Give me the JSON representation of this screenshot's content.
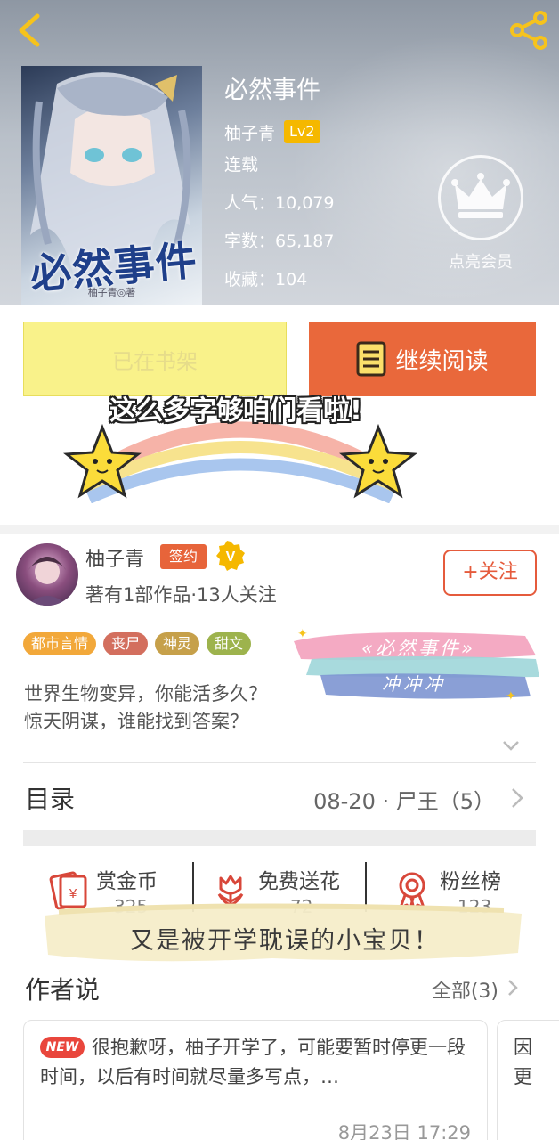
{
  "header": {
    "back_icon": "chevron-left-icon",
    "share_icon": "share-icon"
  },
  "book": {
    "cover_title": "必然事件",
    "cover_author": "柚子青◎著",
    "title": "必然事件",
    "author": "柚子青",
    "level": "Lv2",
    "status": "连载",
    "popularity": "人气：10,079",
    "word_count": "字数：65,187",
    "favorites": "收藏：104"
  },
  "vip": {
    "icon": "crown-icon",
    "label": "点亮会员"
  },
  "actions": {
    "shelf_label": "已在书架",
    "read_label": "继续阅读",
    "read_icon": "book-icon"
  },
  "sticker": {
    "text": "这么多字够咱们看啦!"
  },
  "author_section": {
    "name": "柚子青",
    "sign_badge": "签约",
    "verified_icon": "v-badge-icon",
    "meta": "著有1部作品·13人关注",
    "follow_label": "+关注"
  },
  "tags": [
    {
      "label": "都市言情",
      "color": "#f2a83a"
    },
    {
      "label": "丧尸",
      "color": "#d36f5e"
    },
    {
      "label": "神灵",
      "color": "#c6a04a"
    },
    {
      "label": "甜文",
      "color": "#9db34d"
    }
  ],
  "stamp": {
    "line1": "«必然事件»",
    "line2": "冲冲冲"
  },
  "synopsis": {
    "line1": "世界生物变异，你能活多久？",
    "line2": "惊天阴谋，谁能找到答案？"
  },
  "catalog": {
    "label": "目录",
    "latest": "08-20 · 尸王（5）"
  },
  "stats": [
    {
      "label": "赏金币",
      "value": "325",
      "icon": "red-envelope-icon"
    },
    {
      "label": "免费送花",
      "value": "72",
      "icon": "flower-icon"
    },
    {
      "label": "粉丝榜",
      "value": "123",
      "icon": "medal-icon"
    }
  ],
  "brush": {
    "text": "又是被开学耽误的小宝贝！"
  },
  "author_says": {
    "title": "作者说",
    "all_label": "全部(3)",
    "cards": [
      {
        "badge": "NEW",
        "text": "很抱歉呀，柚子开学了，可能要暂时停更一段时间，以后有时间就尽量多写点，…",
        "time": "8月23日  17:29"
      },
      {
        "text_line1": "因",
        "text_line2": "更"
      }
    ]
  },
  "colors": {
    "accent": "#e9683b",
    "tag_badge": "#e7643a",
    "level_badge": "#f5b800",
    "shelf_button": "#f9f28a"
  }
}
